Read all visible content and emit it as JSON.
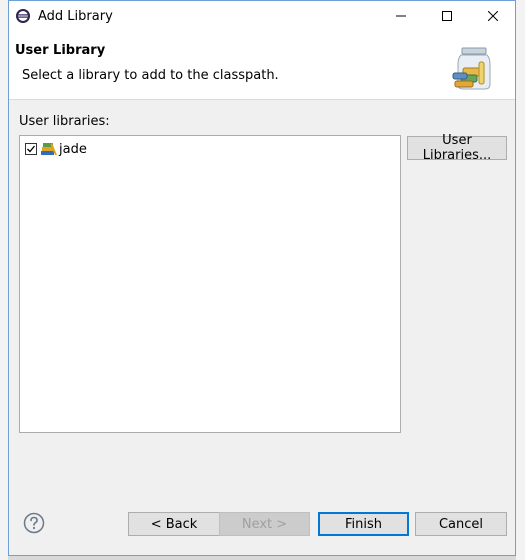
{
  "window": {
    "title": "Add Library",
    "app_icon": "eclipse-icon",
    "controls": [
      "minimize-icon",
      "maximize-icon",
      "close-icon"
    ]
  },
  "header": {
    "title": "User Library",
    "description": "Select a library to add to the classpath.",
    "image": "library-jar-icon"
  },
  "libraries": {
    "label": "User libraries:",
    "items": [
      {
        "name": "jade",
        "checked": true,
        "icon": "library-icon"
      }
    ]
  },
  "buttons": {
    "user_libraries": "User Libraries...",
    "back": "< Back",
    "next": "Next >",
    "finish": "Finish",
    "cancel": "Cancel"
  },
  "colors": {
    "dialog_border": "#6f9fd8",
    "default_button": "#0078d7",
    "help": "#6a7a8c"
  }
}
